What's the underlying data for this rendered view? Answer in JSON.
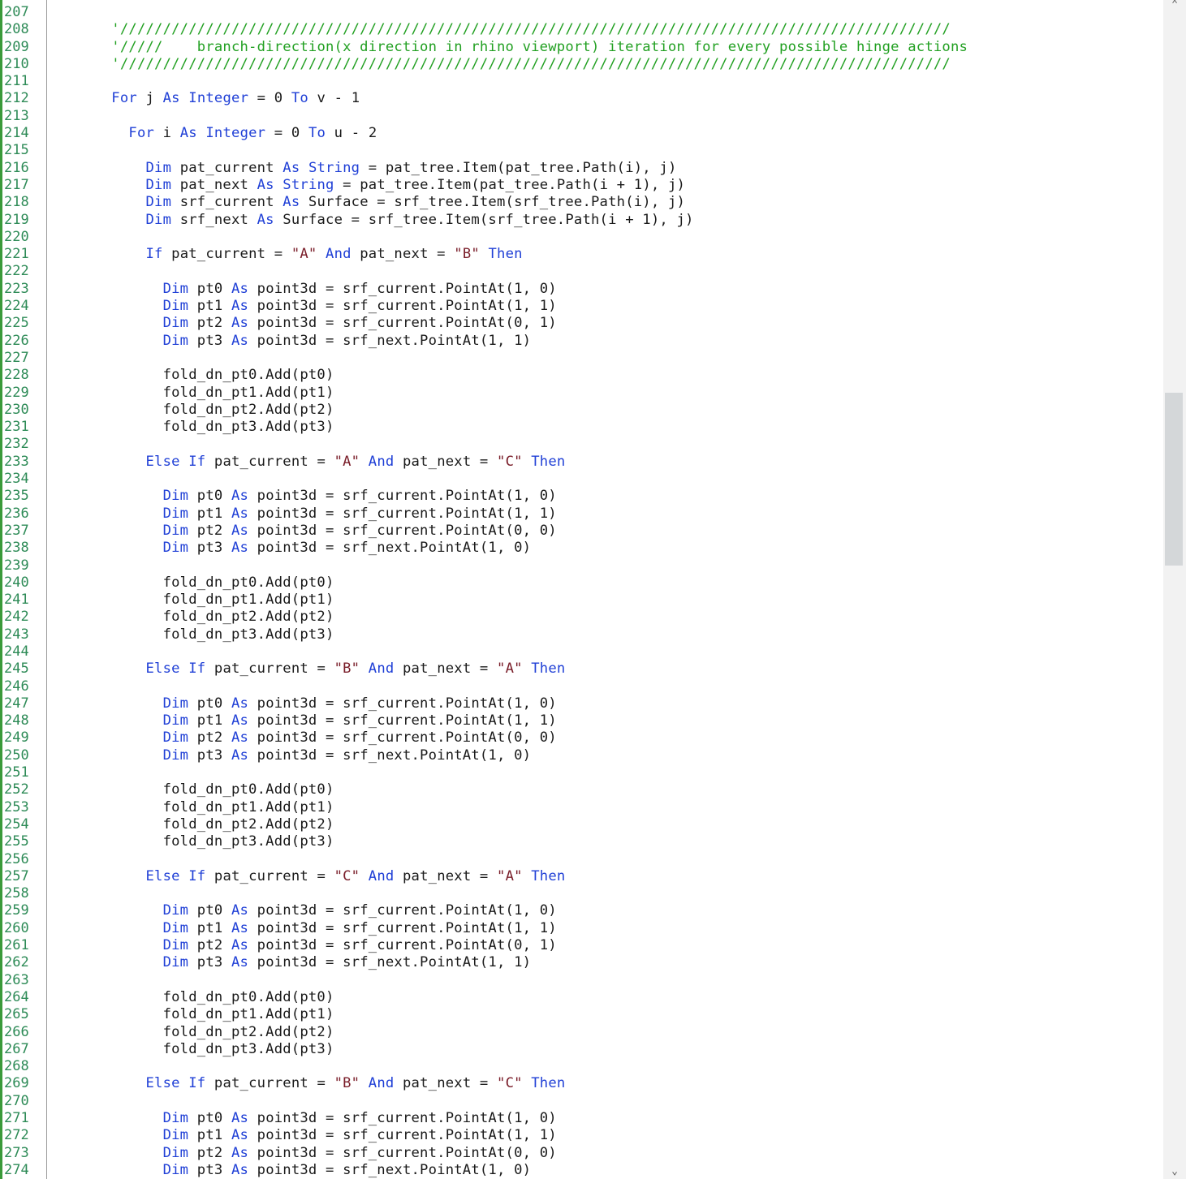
{
  "editor": {
    "lines": [
      {
        "n": "207",
        "t": []
      },
      {
        "n": "208",
        "t": [
          [
            "      ",
            ""
          ],
          [
            "'/////////////////////////////////////////////////////////////////////////////////////////////////",
            "cmt"
          ]
        ]
      },
      {
        "n": "209",
        "t": [
          [
            "      ",
            ""
          ],
          [
            "'/////    branch-direction(x direction in rhino viewport) iteration for every possible hinge actions",
            "cmt"
          ]
        ]
      },
      {
        "n": "210",
        "t": [
          [
            "      ",
            ""
          ],
          [
            "'/////////////////////////////////////////////////////////////////////////////////////////////////",
            "cmt"
          ]
        ]
      },
      {
        "n": "211",
        "t": []
      },
      {
        "n": "212",
        "t": [
          [
            "      ",
            ""
          ],
          [
            "For",
            "kw"
          ],
          [
            " j ",
            ""
          ],
          [
            "As",
            "kw"
          ],
          [
            " ",
            ""
          ],
          [
            "Integer",
            "kw"
          ],
          [
            " = 0 ",
            ""
          ],
          [
            "To",
            "kw"
          ],
          [
            " v - 1",
            ""
          ]
        ]
      },
      {
        "n": "213",
        "t": []
      },
      {
        "n": "214",
        "t": [
          [
            "        ",
            ""
          ],
          [
            "For",
            "kw"
          ],
          [
            " i ",
            ""
          ],
          [
            "As",
            "kw"
          ],
          [
            " ",
            ""
          ],
          [
            "Integer",
            "kw"
          ],
          [
            " = 0 ",
            ""
          ],
          [
            "To",
            "kw"
          ],
          [
            " u - 2",
            ""
          ]
        ]
      },
      {
        "n": "215",
        "t": []
      },
      {
        "n": "216",
        "t": [
          [
            "          ",
            ""
          ],
          [
            "Dim",
            "kw"
          ],
          [
            " pat_current ",
            ""
          ],
          [
            "As",
            "kw"
          ],
          [
            " ",
            ""
          ],
          [
            "String",
            "kw"
          ],
          [
            " = pat_tree.Item(pat_tree.Path(i), j)",
            ""
          ]
        ]
      },
      {
        "n": "217",
        "t": [
          [
            "          ",
            ""
          ],
          [
            "Dim",
            "kw"
          ],
          [
            " pat_next ",
            ""
          ],
          [
            "As",
            "kw"
          ],
          [
            " ",
            ""
          ],
          [
            "String",
            "kw"
          ],
          [
            " = pat_tree.Item(pat_tree.Path(i + 1), j)",
            ""
          ]
        ]
      },
      {
        "n": "218",
        "t": [
          [
            "          ",
            ""
          ],
          [
            "Dim",
            "kw"
          ],
          [
            " srf_current ",
            ""
          ],
          [
            "As",
            "kw"
          ],
          [
            " Surface = srf_tree.Item(srf_tree.Path(i), j)",
            ""
          ]
        ]
      },
      {
        "n": "219",
        "t": [
          [
            "          ",
            ""
          ],
          [
            "Dim",
            "kw"
          ],
          [
            " srf_next ",
            ""
          ],
          [
            "As",
            "kw"
          ],
          [
            " Surface = srf_tree.Item(srf_tree.Path(i + 1), j)",
            ""
          ]
        ]
      },
      {
        "n": "220",
        "t": []
      },
      {
        "n": "221",
        "t": [
          [
            "          ",
            ""
          ],
          [
            "If",
            "kw"
          ],
          [
            " pat_current = ",
            ""
          ],
          [
            "\"A\"",
            "str"
          ],
          [
            " ",
            ""
          ],
          [
            "And",
            "kw"
          ],
          [
            " pat_next = ",
            ""
          ],
          [
            "\"B\"",
            "str"
          ],
          [
            " ",
            ""
          ],
          [
            "Then",
            "kw"
          ]
        ]
      },
      {
        "n": "222",
        "t": []
      },
      {
        "n": "223",
        "t": [
          [
            "            ",
            ""
          ],
          [
            "Dim",
            "kw"
          ],
          [
            " pt0 ",
            ""
          ],
          [
            "As",
            "kw"
          ],
          [
            " point3d = srf_current.PointAt(1, 0)",
            ""
          ]
        ]
      },
      {
        "n": "224",
        "t": [
          [
            "            ",
            ""
          ],
          [
            "Dim",
            "kw"
          ],
          [
            " pt1 ",
            ""
          ],
          [
            "As",
            "kw"
          ],
          [
            " point3d = srf_current.PointAt(1, 1)",
            ""
          ]
        ]
      },
      {
        "n": "225",
        "t": [
          [
            "            ",
            ""
          ],
          [
            "Dim",
            "kw"
          ],
          [
            " pt2 ",
            ""
          ],
          [
            "As",
            "kw"
          ],
          [
            " point3d = srf_current.PointAt(0, 1)",
            ""
          ]
        ]
      },
      {
        "n": "226",
        "t": [
          [
            "            ",
            ""
          ],
          [
            "Dim",
            "kw"
          ],
          [
            " pt3 ",
            ""
          ],
          [
            "As",
            "kw"
          ],
          [
            " point3d = srf_next.PointAt(1, 1)",
            ""
          ]
        ]
      },
      {
        "n": "227",
        "t": []
      },
      {
        "n": "228",
        "t": [
          [
            "            fold_dn_pt0.Add(pt0)",
            ""
          ]
        ]
      },
      {
        "n": "229",
        "t": [
          [
            "            fold_dn_pt1.Add(pt1)",
            ""
          ]
        ]
      },
      {
        "n": "230",
        "t": [
          [
            "            fold_dn_pt2.Add(pt2)",
            ""
          ]
        ]
      },
      {
        "n": "231",
        "t": [
          [
            "            fold_dn_pt3.Add(pt3)",
            ""
          ]
        ]
      },
      {
        "n": "232",
        "t": []
      },
      {
        "n": "233",
        "t": [
          [
            "          ",
            ""
          ],
          [
            "Else",
            "kw"
          ],
          [
            " ",
            ""
          ],
          [
            "If",
            "kw"
          ],
          [
            " pat_current = ",
            ""
          ],
          [
            "\"A\"",
            "str"
          ],
          [
            " ",
            ""
          ],
          [
            "And",
            "kw"
          ],
          [
            " pat_next = ",
            ""
          ],
          [
            "\"C\"",
            "str"
          ],
          [
            " ",
            ""
          ],
          [
            "Then",
            "kw"
          ]
        ]
      },
      {
        "n": "234",
        "t": []
      },
      {
        "n": "235",
        "t": [
          [
            "            ",
            ""
          ],
          [
            "Dim",
            "kw"
          ],
          [
            " pt0 ",
            ""
          ],
          [
            "As",
            "kw"
          ],
          [
            " point3d = srf_current.PointAt(1, 0)",
            ""
          ]
        ]
      },
      {
        "n": "236",
        "t": [
          [
            "            ",
            ""
          ],
          [
            "Dim",
            "kw"
          ],
          [
            " pt1 ",
            ""
          ],
          [
            "As",
            "kw"
          ],
          [
            " point3d = srf_current.PointAt(1, 1)",
            ""
          ]
        ]
      },
      {
        "n": "237",
        "t": [
          [
            "            ",
            ""
          ],
          [
            "Dim",
            "kw"
          ],
          [
            " pt2 ",
            ""
          ],
          [
            "As",
            "kw"
          ],
          [
            " point3d = srf_current.PointAt(0, 0)",
            ""
          ]
        ]
      },
      {
        "n": "238",
        "t": [
          [
            "            ",
            ""
          ],
          [
            "Dim",
            "kw"
          ],
          [
            " pt3 ",
            ""
          ],
          [
            "As",
            "kw"
          ],
          [
            " point3d = srf_next.PointAt(1, 0)",
            ""
          ]
        ]
      },
      {
        "n": "239",
        "t": []
      },
      {
        "n": "240",
        "t": [
          [
            "            fold_dn_pt0.Add(pt0)",
            ""
          ]
        ]
      },
      {
        "n": "241",
        "t": [
          [
            "            fold_dn_pt1.Add(pt1)",
            ""
          ]
        ]
      },
      {
        "n": "242",
        "t": [
          [
            "            fold_dn_pt2.Add(pt2)",
            ""
          ]
        ]
      },
      {
        "n": "243",
        "t": [
          [
            "            fold_dn_pt3.Add(pt3)",
            ""
          ]
        ]
      },
      {
        "n": "244",
        "t": []
      },
      {
        "n": "245",
        "t": [
          [
            "          ",
            ""
          ],
          [
            "Else",
            "kw"
          ],
          [
            " ",
            ""
          ],
          [
            "If",
            "kw"
          ],
          [
            " pat_current = ",
            ""
          ],
          [
            "\"B\"",
            "str"
          ],
          [
            " ",
            ""
          ],
          [
            "And",
            "kw"
          ],
          [
            " pat_next = ",
            ""
          ],
          [
            "\"A\"",
            "str"
          ],
          [
            " ",
            ""
          ],
          [
            "Then",
            "kw"
          ]
        ]
      },
      {
        "n": "246",
        "t": []
      },
      {
        "n": "247",
        "t": [
          [
            "            ",
            ""
          ],
          [
            "Dim",
            "kw"
          ],
          [
            " pt0 ",
            ""
          ],
          [
            "As",
            "kw"
          ],
          [
            " point3d = srf_current.PointAt(1, 0)",
            ""
          ]
        ]
      },
      {
        "n": "248",
        "t": [
          [
            "            ",
            ""
          ],
          [
            "Dim",
            "kw"
          ],
          [
            " pt1 ",
            ""
          ],
          [
            "As",
            "kw"
          ],
          [
            " point3d = srf_current.PointAt(1, 1)",
            ""
          ]
        ]
      },
      {
        "n": "249",
        "t": [
          [
            "            ",
            ""
          ],
          [
            "Dim",
            "kw"
          ],
          [
            " pt2 ",
            ""
          ],
          [
            "As",
            "kw"
          ],
          [
            " point3d = srf_current.PointAt(0, 0)",
            ""
          ]
        ]
      },
      {
        "n": "250",
        "t": [
          [
            "            ",
            ""
          ],
          [
            "Dim",
            "kw"
          ],
          [
            " pt3 ",
            ""
          ],
          [
            "As",
            "kw"
          ],
          [
            " point3d = srf_next.PointAt(1, 0)",
            ""
          ]
        ]
      },
      {
        "n": "251",
        "t": []
      },
      {
        "n": "252",
        "t": [
          [
            "            fold_dn_pt0.Add(pt0)",
            ""
          ]
        ]
      },
      {
        "n": "253",
        "t": [
          [
            "            fold_dn_pt1.Add(pt1)",
            ""
          ]
        ]
      },
      {
        "n": "254",
        "t": [
          [
            "            fold_dn_pt2.Add(pt2)",
            ""
          ]
        ]
      },
      {
        "n": "255",
        "t": [
          [
            "            fold_dn_pt3.Add(pt3)",
            ""
          ]
        ]
      },
      {
        "n": "256",
        "t": []
      },
      {
        "n": "257",
        "t": [
          [
            "          ",
            ""
          ],
          [
            "Else",
            "kw"
          ],
          [
            " ",
            ""
          ],
          [
            "If",
            "kw"
          ],
          [
            " pat_current = ",
            ""
          ],
          [
            "\"C\"",
            "str"
          ],
          [
            " ",
            ""
          ],
          [
            "And",
            "kw"
          ],
          [
            " pat_next = ",
            ""
          ],
          [
            "\"A\"",
            "str"
          ],
          [
            " ",
            ""
          ],
          [
            "Then",
            "kw"
          ]
        ]
      },
      {
        "n": "258",
        "t": []
      },
      {
        "n": "259",
        "t": [
          [
            "            ",
            ""
          ],
          [
            "Dim",
            "kw"
          ],
          [
            " pt0 ",
            ""
          ],
          [
            "As",
            "kw"
          ],
          [
            " point3d = srf_current.PointAt(1, 0)",
            ""
          ]
        ]
      },
      {
        "n": "260",
        "t": [
          [
            "            ",
            ""
          ],
          [
            "Dim",
            "kw"
          ],
          [
            " pt1 ",
            ""
          ],
          [
            "As",
            "kw"
          ],
          [
            " point3d = srf_current.PointAt(1, 1)",
            ""
          ]
        ]
      },
      {
        "n": "261",
        "t": [
          [
            "            ",
            ""
          ],
          [
            "Dim",
            "kw"
          ],
          [
            " pt2 ",
            ""
          ],
          [
            "As",
            "kw"
          ],
          [
            " point3d = srf_current.PointAt(0, 1)",
            ""
          ]
        ]
      },
      {
        "n": "262",
        "t": [
          [
            "            ",
            ""
          ],
          [
            "Dim",
            "kw"
          ],
          [
            " pt3 ",
            ""
          ],
          [
            "As",
            "kw"
          ],
          [
            " point3d = srf_next.PointAt(1, 1)",
            ""
          ]
        ]
      },
      {
        "n": "263",
        "t": []
      },
      {
        "n": "264",
        "t": [
          [
            "            fold_dn_pt0.Add(pt0)",
            ""
          ]
        ]
      },
      {
        "n": "265",
        "t": [
          [
            "            fold_dn_pt1.Add(pt1)",
            ""
          ]
        ]
      },
      {
        "n": "266",
        "t": [
          [
            "            fold_dn_pt2.Add(pt2)",
            ""
          ]
        ]
      },
      {
        "n": "267",
        "t": [
          [
            "            fold_dn_pt3.Add(pt3)",
            ""
          ]
        ]
      },
      {
        "n": "268",
        "t": []
      },
      {
        "n": "269",
        "t": [
          [
            "          ",
            ""
          ],
          [
            "Else",
            "kw"
          ],
          [
            " ",
            ""
          ],
          [
            "If",
            "kw"
          ],
          [
            " pat_current = ",
            ""
          ],
          [
            "\"B\"",
            "str"
          ],
          [
            " ",
            ""
          ],
          [
            "And",
            "kw"
          ],
          [
            " pat_next = ",
            ""
          ],
          [
            "\"C\"",
            "str"
          ],
          [
            " ",
            ""
          ],
          [
            "Then",
            "kw"
          ]
        ]
      },
      {
        "n": "270",
        "t": []
      },
      {
        "n": "271",
        "t": [
          [
            "            ",
            ""
          ],
          [
            "Dim",
            "kw"
          ],
          [
            " pt0 ",
            ""
          ],
          [
            "As",
            "kw"
          ],
          [
            " point3d = srf_current.PointAt(1, 0)",
            ""
          ]
        ]
      },
      {
        "n": "272",
        "t": [
          [
            "            ",
            ""
          ],
          [
            "Dim",
            "kw"
          ],
          [
            " pt1 ",
            ""
          ],
          [
            "As",
            "kw"
          ],
          [
            " point3d = srf_current.PointAt(1, 1)",
            ""
          ]
        ]
      },
      {
        "n": "273",
        "t": [
          [
            "            ",
            ""
          ],
          [
            "Dim",
            "kw"
          ],
          [
            " pt2 ",
            ""
          ],
          [
            "As",
            "kw"
          ],
          [
            " point3d = srf_current.PointAt(0, 0)",
            ""
          ]
        ]
      },
      {
        "n": "274",
        "t": [
          [
            "            ",
            ""
          ],
          [
            "Dim",
            "kw"
          ],
          [
            " pt3 ",
            ""
          ],
          [
            "As",
            "kw"
          ],
          [
            " point3d = srf_next.PointAt(1, 0)",
            ""
          ]
        ]
      }
    ]
  },
  "scrollbar": {
    "up_glyph": "⌃",
    "down_glyph": "⌄",
    "thumb_position_fraction": 0.33,
    "thumb_size_fraction": 0.15
  },
  "colors": {
    "keyword": "#1f3fd6",
    "string": "#7a1e2a",
    "comment": "#22a022",
    "line_number": "#2e8b57",
    "text": "#1a1a1a"
  }
}
